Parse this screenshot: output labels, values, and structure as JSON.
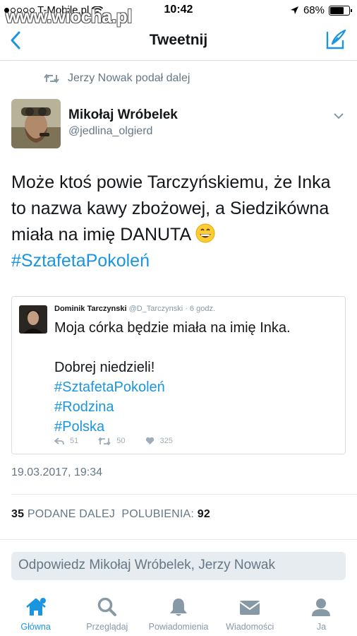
{
  "status_bar": {
    "carrier": "T-Mobile.pl",
    "time": "10:42",
    "battery": "68%",
    "battery_level": 0.68
  },
  "watermark": "www.wiocha.pl",
  "nav": {
    "title": "Tweetnij"
  },
  "retweet_line": "Jerzy Nowak podał dalej",
  "tweet": {
    "author_name": "Mikołaj Wróbelek",
    "author_handle": "@jedlina_olgierd",
    "text_plain": "Może ktoś powie Tarczyńskiemu, że Inka to nazwa kawy zbożowej, a Siedzikówna miała na imię DANUTA",
    "hashtag": "#SztafetaPokoleń",
    "timestamp": "19.03.2017, 19:34"
  },
  "quoted_tweet": {
    "author_name": "Dominik Tarczynski",
    "author_handle": "@D_Tarczynski",
    "time_ago": "· 6 godz.",
    "line1": "Moja córka będzie miała na imię Inka.",
    "line2": "Dobrej niedzieli!",
    "hashtags": [
      "#SztafetaPokoleń",
      "#Rodzina",
      "#Polska"
    ],
    "replies": "51",
    "retweets": "50",
    "likes": "325"
  },
  "stats": {
    "retweets_count": "35",
    "retweets_label": "PODANE DALEJ",
    "likes_label": "POLUBIENIA:",
    "likes_count": "92"
  },
  "reply_placeholder": "Odpowiedz Mikołaj Wróbelek, Jerzy Nowak",
  "tabs": [
    {
      "label": "Główna",
      "icon": "home-icon",
      "active": true
    },
    {
      "label": "Przeglądaj",
      "icon": "search-icon",
      "active": false
    },
    {
      "label": "Powiadomienia",
      "icon": "bell-icon",
      "active": false
    },
    {
      "label": "Wiadomości",
      "icon": "envelope-icon",
      "active": false
    },
    {
      "label": "Ja",
      "icon": "profile-icon",
      "active": false
    }
  ],
  "colors": {
    "accent": "#1b95e0",
    "text": "#14171a",
    "muted": "#657786"
  }
}
